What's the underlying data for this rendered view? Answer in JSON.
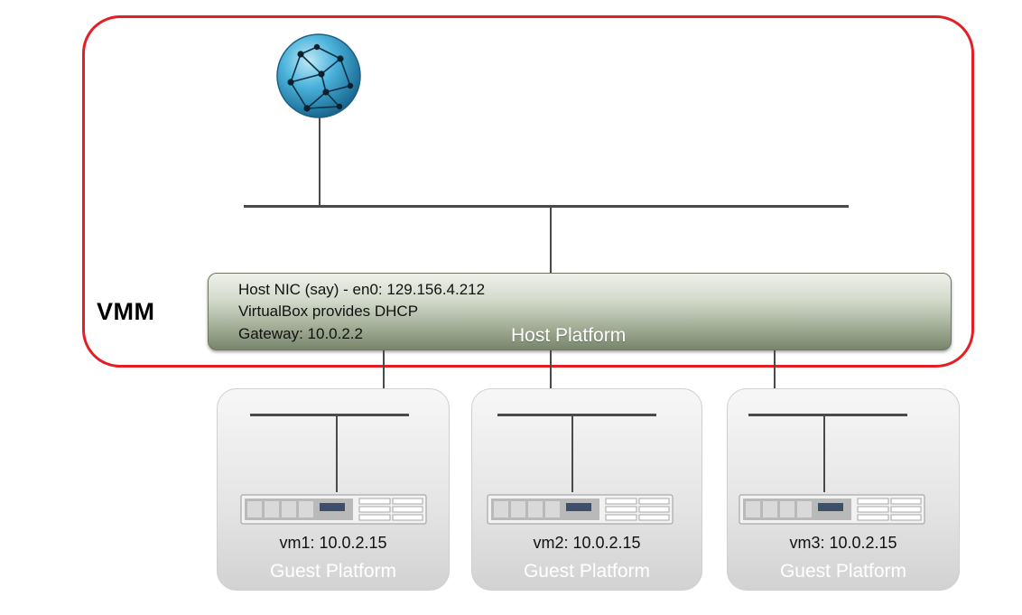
{
  "vmm": {
    "label": "VMM"
  },
  "host": {
    "nic_line": "Host NIC (say) - en0: 129.156.4.212",
    "dhcp_line": "VirtualBox provides DHCP",
    "gateway_line": "Gateway: 10.0.2.2",
    "title": "Host Platform"
  },
  "guests": [
    {
      "ip_label": "vm1: 10.0.2.15",
      "title": "Guest Platform"
    },
    {
      "ip_label": "vm2: 10.0.2.15",
      "title": "Guest Platform"
    },
    {
      "ip_label": "vm3: 10.0.2.15",
      "title": "Guest Platform"
    }
  ],
  "colors": {
    "vmm_border": "#e41e25",
    "host_bar_dark": "#78846c",
    "globe": "#3aa3cf",
    "lines": "#4a4a4a"
  },
  "icons": [
    "globe-icon",
    "server-icon"
  ]
}
